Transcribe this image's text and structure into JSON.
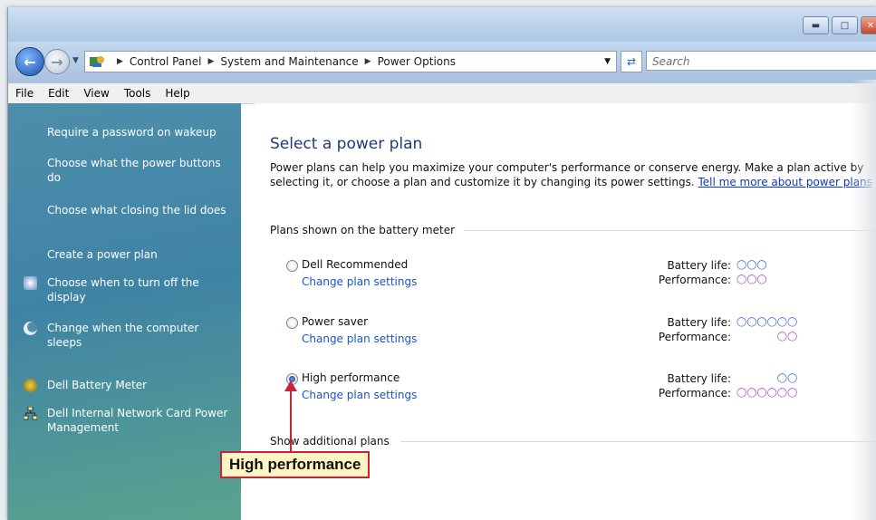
{
  "window": {
    "caption_buttons": [
      "minimize-icon",
      "maximize-icon",
      "close-icon"
    ]
  },
  "address_bar": {
    "breadcrumbs": [
      "Control Panel",
      "System and Maintenance",
      "Power Options"
    ],
    "search_placeholder": "Search"
  },
  "menu": [
    "File",
    "Edit",
    "View",
    "Tools",
    "Help"
  ],
  "sidebar": {
    "items": [
      {
        "label": "Require a password on wakeup",
        "icon": ""
      },
      {
        "label": "Choose what the power buttons do",
        "icon": ""
      },
      {
        "label": "Choose what closing the lid does",
        "icon": ""
      },
      {
        "label": "Create a power plan",
        "icon": ""
      },
      {
        "label": "Choose when to turn off the display",
        "icon": "display-icon"
      },
      {
        "label": "Change when the computer sleeps",
        "icon": "moon-icon"
      },
      {
        "label": "Dell Battery Meter",
        "icon": "battery-meter-icon"
      },
      {
        "label": "Dell Internal Network Card Power Management",
        "icon": "network-icon"
      }
    ]
  },
  "main": {
    "title": "Select a power plan",
    "description": "Power plans can help you maximize your computer's performance or conserve energy. Make a plan active by selecting it, or choose a plan and customize it by changing its power settings.",
    "description_link": "Tell me more about power plans",
    "group_label": "Plans shown on the battery meter",
    "plans": [
      {
        "name": "Dell Recommended",
        "change": "Change plan settings",
        "selected": false,
        "battery_life": 3,
        "performance": 3
      },
      {
        "name": "Power saver",
        "change": "Change plan settings",
        "selected": false,
        "battery_life": 6,
        "performance": 2
      },
      {
        "name": "High performance",
        "change": "Change plan settings",
        "selected": true,
        "battery_life": 2,
        "performance": 6
      }
    ],
    "battery_label": "Battery life:",
    "performance_label": "Performance:",
    "show_additional": "Show additional plans"
  },
  "callout": {
    "text": "High performance"
  },
  "colors": {
    "accent_link": "#1a54c9",
    "callout_border": "#c6243a",
    "callout_bg": "#fdf3c3",
    "sidebar": "#4d8eab"
  }
}
